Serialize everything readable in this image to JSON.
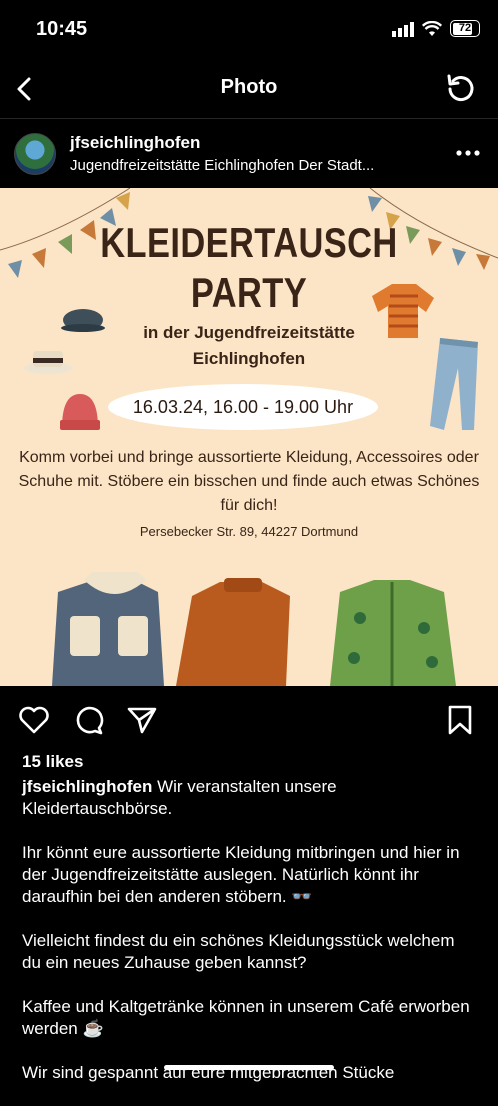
{
  "status_bar": {
    "time": "10:45",
    "battery": "72"
  },
  "nav": {
    "title": "Photo"
  },
  "post_header": {
    "username": "jfseichlinghofen",
    "location": "Jugendfreizeitstätte Eichlinghofen Der Stadt..."
  },
  "poster": {
    "title_line1": "KLEIDERTAUSCH",
    "title_line2": "PARTY",
    "subtitle_line1": "in der Jugendfreizeitstätte",
    "subtitle_line2": "Eichlinghofen",
    "datetime": "16.03.24, 16.00 - 19.00 Uhr",
    "body": "Komm vorbei und bringe aussortierte Kleidung, Accessoires oder Schuhe mit. Stöbere ein bisschen und finde auch etwas Schönes für dich!",
    "address": "Persebecker Str. 89, 44227 Dortmund"
  },
  "likes": "15 likes",
  "caption": {
    "username": "jfseichlinghofen",
    "p1": "Wir veranstalten unsere Kleidertauschbörse.",
    "p2": "Ihr könnt eure aussortierte Kleidung mitbringen und hier in der Jugendfreizeitstätte auslegen. Natürlich könnt ihr daraufhin bei den anderen stöbern. 👓",
    "p3": "Vielleicht findest du ein schönes Kleidungsstück welchem du ein neues Zuhause geben kannst?",
    "p4": "Kaffee und Kaltgetränke können in unserem Café erworben werden ☕",
    "p5": "Wir sind gespannt auf eure mitgebrachten Stücke"
  },
  "colors": {
    "poster_bg": "#fbe5c6",
    "poster_text": "#3a2418"
  }
}
